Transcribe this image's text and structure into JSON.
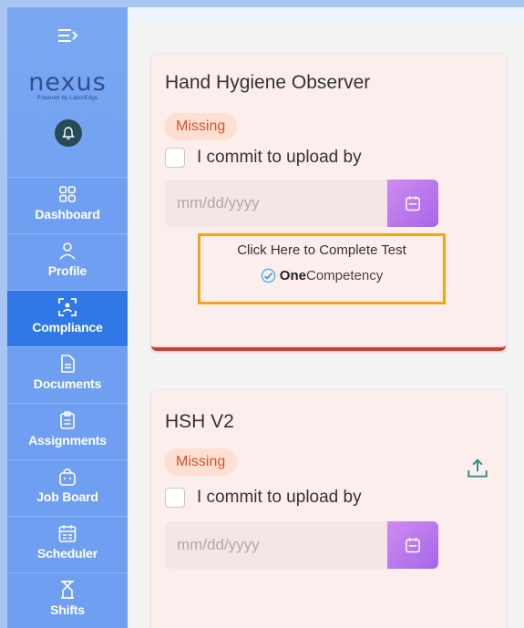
{
  "sidebar": {
    "logo": {
      "word": "nexus",
      "tagline": "Powered by LaborEdge"
    },
    "items": [
      {
        "label": "Dashboard",
        "icon": "grid-icon",
        "active": false
      },
      {
        "label": "Profile",
        "icon": "person-icon",
        "active": false
      },
      {
        "label": "Compliance",
        "icon": "face-scan-icon",
        "active": true
      },
      {
        "label": "Documents",
        "icon": "document-icon",
        "active": false
      },
      {
        "label": "Assignments",
        "icon": "clipboard-icon",
        "active": false
      },
      {
        "label": "Job Board",
        "icon": "bag-icon",
        "active": false
      },
      {
        "label": "Scheduler",
        "icon": "calendar-icon",
        "active": false
      },
      {
        "label": "Shifts",
        "icon": "hourglass-icon",
        "active": false
      }
    ]
  },
  "cards": [
    {
      "title": "Hand Hygiene Observer",
      "status": "Missing",
      "commit_label": "I commit to upload by",
      "date_placeholder": "mm/dd/yyyy",
      "test_prompt": "Click Here to Complete Test",
      "test_brand_one": "One",
      "test_brand_rest": "Competency"
    },
    {
      "title": "HSH V2",
      "status": "Missing",
      "commit_label": "I commit to upload by",
      "date_placeholder": "mm/dd/yyyy"
    }
  ],
  "colors": {
    "sidebar": "#6f9ff1",
    "sidebar_active": "#2f78e6",
    "card_bg": "#fdeeee",
    "missing_text": "#d2552a",
    "missing_bg": "#fde0d2",
    "accent_purple": "#b878ec",
    "highlight_border": "#f0a41a",
    "error_border": "#d73a2a",
    "upload_icon": "#2a8f86"
  }
}
